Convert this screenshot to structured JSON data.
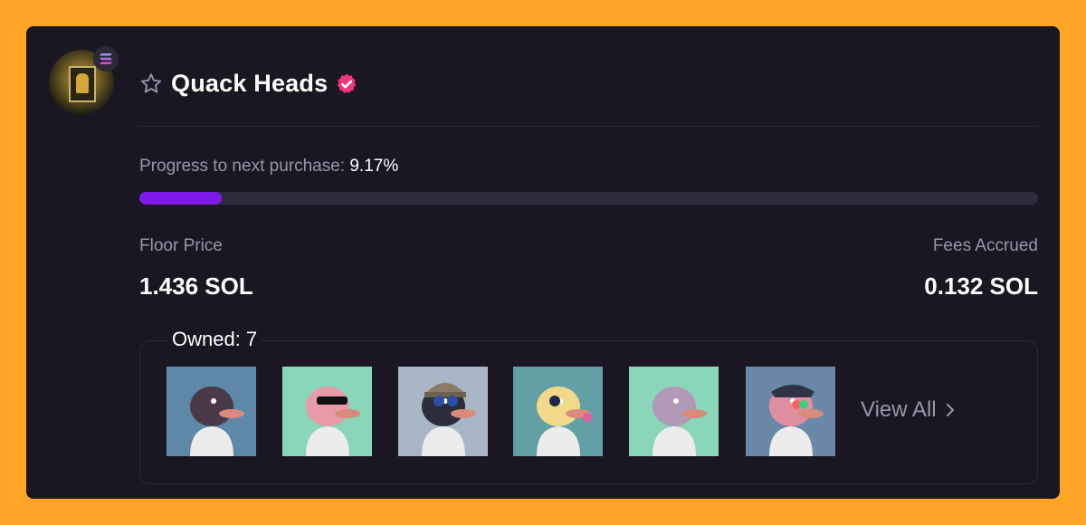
{
  "collection": {
    "name": "Quack Heads"
  },
  "progress": {
    "label": "Progress to next purchase:",
    "value_text": "9.17%",
    "fraction": 0.0917
  },
  "stats": {
    "floor_label": "Floor Price",
    "floor_value": "1.436 SOL",
    "fees_label": "Fees Accrued",
    "fees_value": "0.132 SOL"
  },
  "owned": {
    "label": "Owned: 7",
    "view_all": "View All",
    "items": [
      {
        "bg": "#5f88a8",
        "duck": "#4a3948",
        "accessory": "none"
      },
      {
        "bg": "#8ad6b8",
        "duck": "#e89aa8",
        "accessory": "sunglasses"
      },
      {
        "bg": "#a9b6c6",
        "duck": "#2c2d3a",
        "accessory": "beanie"
      },
      {
        "bg": "#63a0a6",
        "duck": "#f2d98a",
        "accessory": "eyepatch"
      },
      {
        "bg": "#8ad6b8",
        "duck": "#b09ab8",
        "accessory": "none"
      },
      {
        "bg": "#6b88a8",
        "duck": "#e08fa0",
        "accessory": "bandana"
      }
    ]
  },
  "colors": {
    "background": "#ffa424",
    "card": "#1a1622",
    "accent": "#7f19ea",
    "verified": "#f0357a"
  },
  "icons": {
    "chain": "solana-icon",
    "favorite": "star-outline-icon",
    "verified": "verified-check-icon",
    "view_all": "chevron-right-icon"
  }
}
